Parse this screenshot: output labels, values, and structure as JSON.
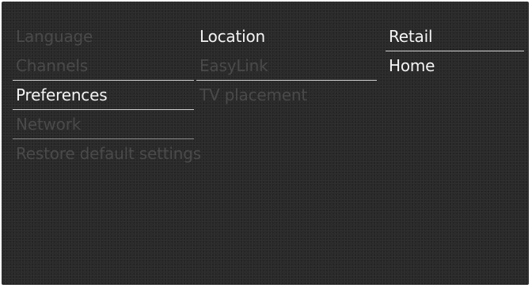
{
  "menu": {
    "column1": [
      {
        "label": "Language",
        "state": "dim"
      },
      {
        "label": "Channels",
        "state": "dim"
      },
      {
        "label": "Preferences",
        "state": "selected"
      },
      {
        "label": "Network",
        "state": "dim"
      },
      {
        "label": "Restore default settings",
        "state": "dim"
      }
    ],
    "column2": [
      {
        "label": "Location",
        "state": "selected"
      },
      {
        "label": "EasyLink",
        "state": "dim"
      },
      {
        "label": "TV placement",
        "state": "dim"
      }
    ],
    "column3": [
      {
        "label": "Retail",
        "state": "normal"
      },
      {
        "label": "Home",
        "state": "normal"
      }
    ]
  },
  "colors": {
    "background": "#2a2a2a",
    "text_bright": "#f4f4f4",
    "text_dim": "#4a4a4a",
    "separator": "#cfcfcf"
  }
}
